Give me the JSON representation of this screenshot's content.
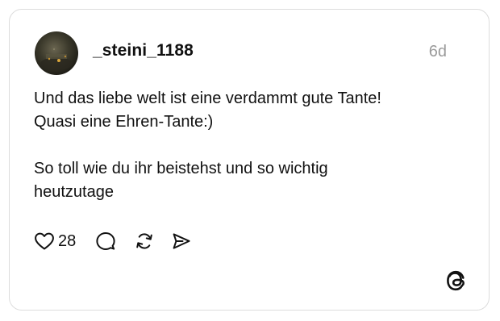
{
  "post": {
    "username": "_steini_1188",
    "timestamp": "6d",
    "lines": [
      "Und das liebe welt ist eine verdammt gute Tante!",
      "Quasi eine Ehren-Tante:)",
      "",
      "So toll wie du ihr beistehst und so wichtig",
      "heutzutage"
    ],
    "like_count": "28"
  },
  "icons": {
    "like": "heart-icon",
    "reply": "comment-bubble-icon",
    "repost": "repost-icon",
    "share": "send-icon",
    "brand": "threads-logo-icon"
  },
  "colors": {
    "text": "#111111",
    "muted": "#9a9a9a",
    "border": "#dcdcdc"
  }
}
